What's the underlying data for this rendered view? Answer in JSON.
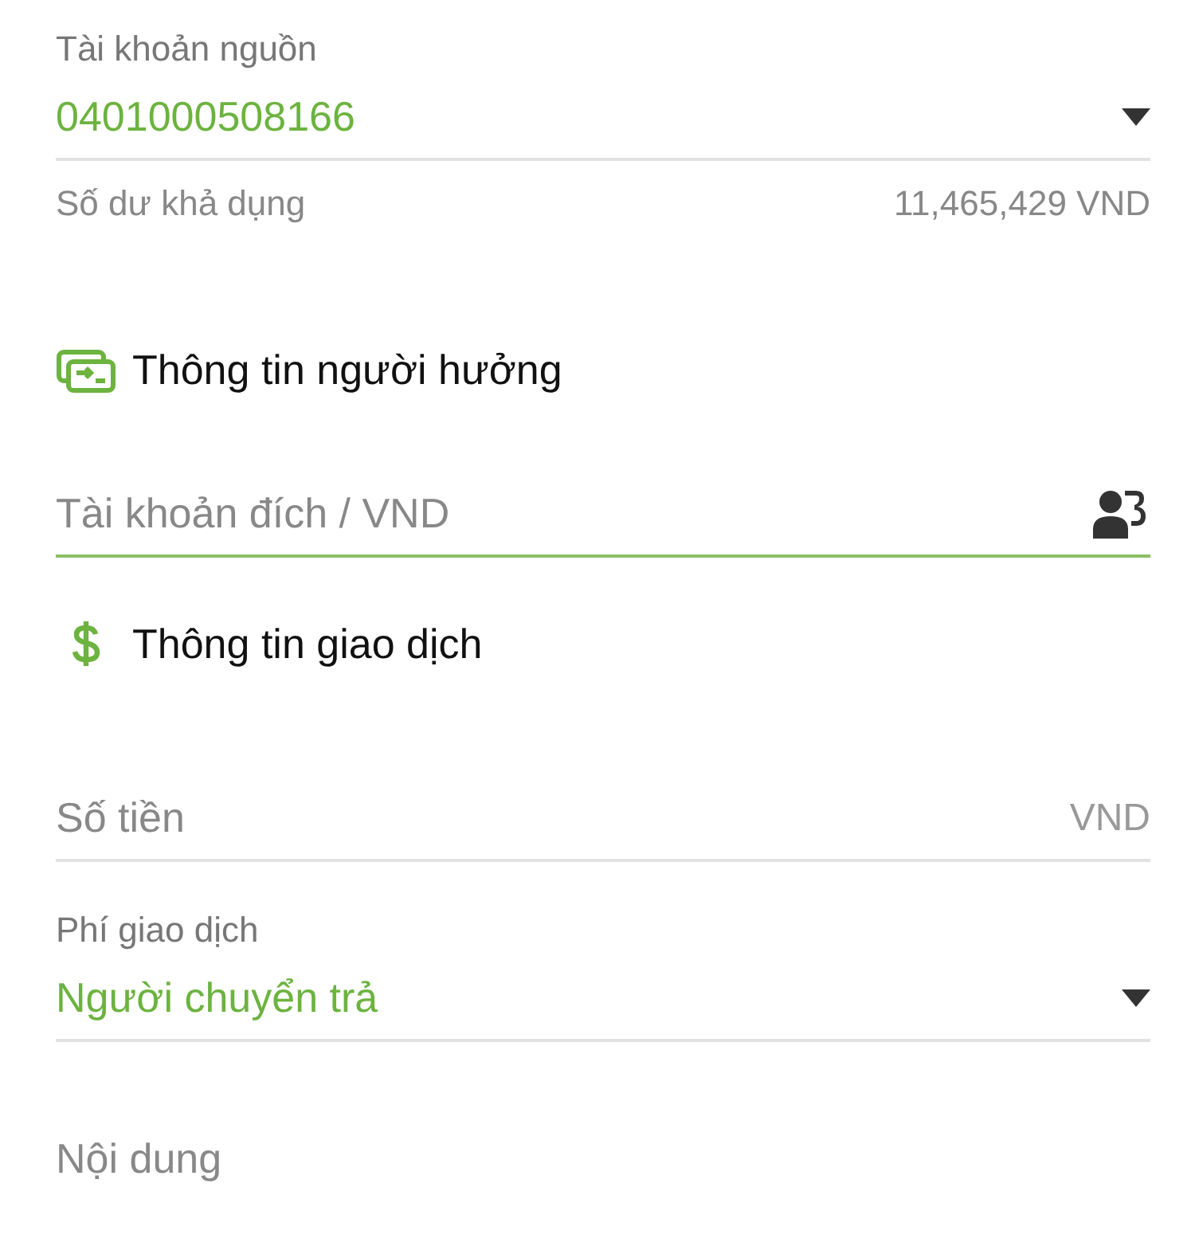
{
  "source_account": {
    "label": "Tài khoản nguồn",
    "value": "0401000508166",
    "balance_label": "Số dư khả dụng",
    "balance": "11,465,429 VND"
  },
  "beneficiary": {
    "title": "Thông tin người hưởng",
    "account_field": {
      "placeholder": "Tài khoản đích / VND",
      "focused": true
    }
  },
  "transaction": {
    "title": "Thông tin giao dịch",
    "amount_field": {
      "placeholder": "Số tiền",
      "unit": "VND"
    },
    "fee": {
      "label": "Phí giao dịch",
      "value": "Người chuyển trả"
    },
    "content_field": {
      "placeholder": "Nội dung"
    }
  }
}
